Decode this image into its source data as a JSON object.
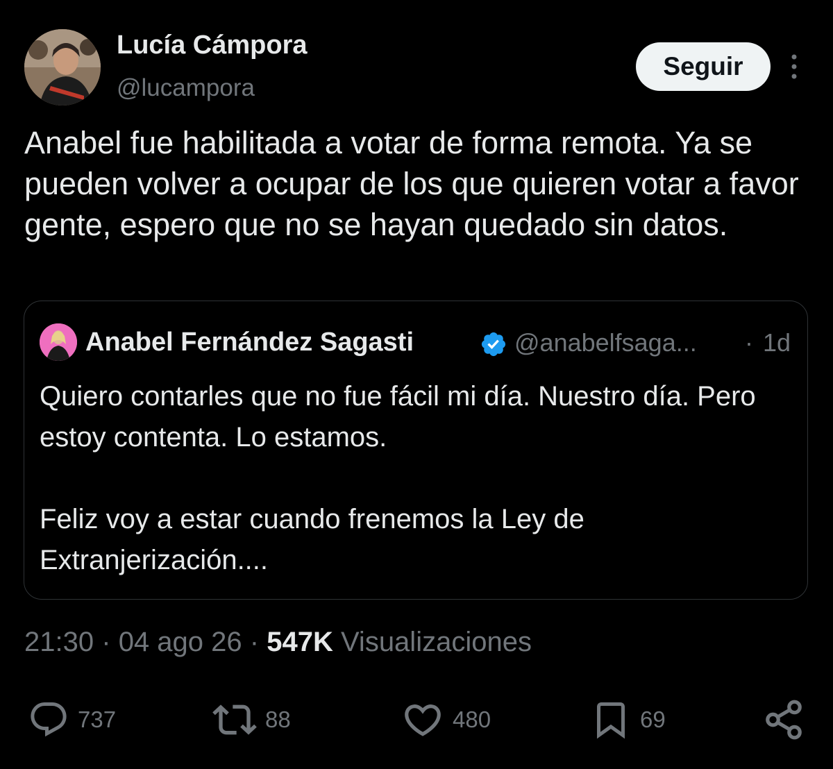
{
  "author": {
    "display_name": "Lucía Cámpora",
    "handle": "@lucampora"
  },
  "follow_button_label": "Seguir",
  "tweet_text": "Anabel fue habilitada a votar de forma remota. Ya se pueden volver a ocupar de los que quieren votar a favor gente, espero que no se hayan quedado sin datos.",
  "quoted_tweet": {
    "display_name": "Anabel Fernández Sagasti",
    "handle": "@anabelfsaga...",
    "separator": "·",
    "time": "1d",
    "text": "Quiero contarles que no fue fácil mi día. Nuestro día. Pero estoy contenta. Lo estamos.\n\nFeliz voy a estar cuando frenemos la Ley de Extranjerización...."
  },
  "meta": {
    "time": "21:30",
    "dot": "·",
    "date": "04 ago 26",
    "views_count": "547K",
    "views_label": "Visualizaciones"
  },
  "actions": {
    "replies": "737",
    "retweets": "88",
    "likes": "480",
    "bookmarks": "69"
  },
  "colors": {
    "background": "#000000",
    "text_primary": "#e7e9ea",
    "text_secondary": "#71767b",
    "border": "#2f3336",
    "verified": "#1d9bf0",
    "follow_bg": "#eff3f4"
  },
  "icons": {
    "reply": "reply-icon",
    "retweet": "retweet-icon",
    "like": "heart-icon",
    "bookmark": "bookmark-icon",
    "share": "share-icon",
    "more": "more-vertical-icon",
    "verified": "verified-badge-icon"
  }
}
